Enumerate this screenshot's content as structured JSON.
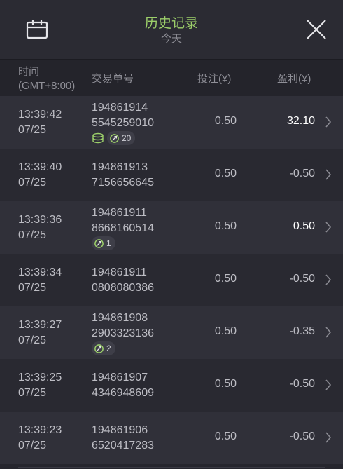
{
  "header": {
    "title": "历史记录",
    "subtitle": "今天",
    "calendar_icon": "calendar-icon",
    "close_icon": "close-icon"
  },
  "columns": {
    "time_line1": "时间",
    "time_line2": "(GMT+8:00)",
    "txn_id": "交易单号",
    "bet": "投注(¥)",
    "profit": "盈利(¥)"
  },
  "colors": {
    "title": "#9ccf6a",
    "row_odd": "#303039",
    "row_even": "#292931",
    "positive_profit": "#ffffff"
  },
  "rows": [
    {
      "time": "13:39:42",
      "date": "07/25",
      "id1": "194861914",
      "id2": "5545259010",
      "bet": "0.50",
      "profit": "32.10",
      "positive": true,
      "coins": true,
      "badge": "20"
    },
    {
      "time": "13:39:40",
      "date": "07/25",
      "id1": "194861913",
      "id2": "7156656645",
      "bet": "0.50",
      "profit": "-0.50",
      "positive": false,
      "coins": false,
      "badge": ""
    },
    {
      "time": "13:39:36",
      "date": "07/25",
      "id1": "194861911",
      "id2": "8668160514",
      "bet": "0.50",
      "profit": "0.50",
      "positive": true,
      "coins": false,
      "badge": "1"
    },
    {
      "time": "13:39:34",
      "date": "07/25",
      "id1": "194861911",
      "id2": "0808080386",
      "bet": "0.50",
      "profit": "-0.50",
      "positive": false,
      "coins": false,
      "badge": ""
    },
    {
      "time": "13:39:27",
      "date": "07/25",
      "id1": "194861908",
      "id2": "2903323136",
      "bet": "0.50",
      "profit": "-0.35",
      "positive": false,
      "coins": false,
      "badge": "2"
    },
    {
      "time": "13:39:25",
      "date": "07/25",
      "id1": "194861907",
      "id2": "4346948609",
      "bet": "0.50",
      "profit": "-0.50",
      "positive": false,
      "coins": false,
      "badge": ""
    },
    {
      "time": "13:39:23",
      "date": "07/25",
      "id1": "194861906",
      "id2": "6520417283",
      "bet": "0.50",
      "profit": "-0.50",
      "positive": false,
      "coins": false,
      "badge": ""
    }
  ]
}
